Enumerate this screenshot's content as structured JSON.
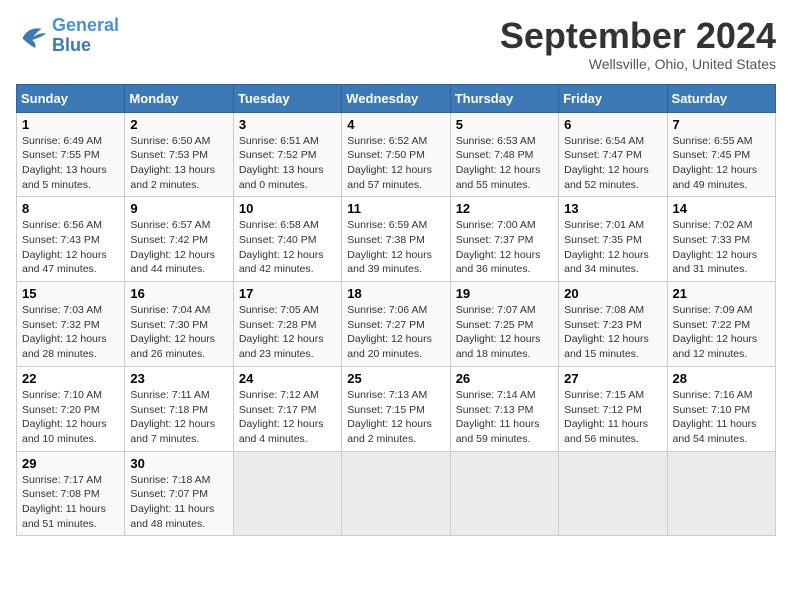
{
  "header": {
    "logo_line1": "General",
    "logo_line2": "Blue",
    "month_title": "September 2024",
    "location": "Wellsville, Ohio, United States"
  },
  "calendar": {
    "days_of_week": [
      "Sunday",
      "Monday",
      "Tuesday",
      "Wednesday",
      "Thursday",
      "Friday",
      "Saturday"
    ],
    "weeks": [
      [
        {
          "day": null,
          "empty": true
        },
        {
          "day": null,
          "empty": true
        },
        {
          "day": null,
          "empty": true
        },
        {
          "day": null,
          "empty": true
        },
        {
          "day": null,
          "empty": true
        },
        {
          "day": null,
          "empty": true
        },
        {
          "day": null,
          "empty": true
        }
      ],
      [
        {
          "day": "1",
          "sunrise": "6:49 AM",
          "sunset": "7:55 PM",
          "daylight": "13 hours and 5 minutes."
        },
        {
          "day": "2",
          "sunrise": "6:50 AM",
          "sunset": "7:53 PM",
          "daylight": "13 hours and 2 minutes."
        },
        {
          "day": "3",
          "sunrise": "6:51 AM",
          "sunset": "7:52 PM",
          "daylight": "13 hours and 0 minutes."
        },
        {
          "day": "4",
          "sunrise": "6:52 AM",
          "sunset": "7:50 PM",
          "daylight": "12 hours and 57 minutes."
        },
        {
          "day": "5",
          "sunrise": "6:53 AM",
          "sunset": "7:48 PM",
          "daylight": "12 hours and 55 minutes."
        },
        {
          "day": "6",
          "sunrise": "6:54 AM",
          "sunset": "7:47 PM",
          "daylight": "12 hours and 52 minutes."
        },
        {
          "day": "7",
          "sunrise": "6:55 AM",
          "sunset": "7:45 PM",
          "daylight": "12 hours and 49 minutes."
        }
      ],
      [
        {
          "day": "8",
          "sunrise": "6:56 AM",
          "sunset": "7:43 PM",
          "daylight": "12 hours and 47 minutes."
        },
        {
          "day": "9",
          "sunrise": "6:57 AM",
          "sunset": "7:42 PM",
          "daylight": "12 hours and 44 minutes."
        },
        {
          "day": "10",
          "sunrise": "6:58 AM",
          "sunset": "7:40 PM",
          "daylight": "12 hours and 42 minutes."
        },
        {
          "day": "11",
          "sunrise": "6:59 AM",
          "sunset": "7:38 PM",
          "daylight": "12 hours and 39 minutes."
        },
        {
          "day": "12",
          "sunrise": "7:00 AM",
          "sunset": "7:37 PM",
          "daylight": "12 hours and 36 minutes."
        },
        {
          "day": "13",
          "sunrise": "7:01 AM",
          "sunset": "7:35 PM",
          "daylight": "12 hours and 34 minutes."
        },
        {
          "day": "14",
          "sunrise": "7:02 AM",
          "sunset": "7:33 PM",
          "daylight": "12 hours and 31 minutes."
        }
      ],
      [
        {
          "day": "15",
          "sunrise": "7:03 AM",
          "sunset": "7:32 PM",
          "daylight": "12 hours and 28 minutes."
        },
        {
          "day": "16",
          "sunrise": "7:04 AM",
          "sunset": "7:30 PM",
          "daylight": "12 hours and 26 minutes."
        },
        {
          "day": "17",
          "sunrise": "7:05 AM",
          "sunset": "7:28 PM",
          "daylight": "12 hours and 23 minutes."
        },
        {
          "day": "18",
          "sunrise": "7:06 AM",
          "sunset": "7:27 PM",
          "daylight": "12 hours and 20 minutes."
        },
        {
          "day": "19",
          "sunrise": "7:07 AM",
          "sunset": "7:25 PM",
          "daylight": "12 hours and 18 minutes."
        },
        {
          "day": "20",
          "sunrise": "7:08 AM",
          "sunset": "7:23 PM",
          "daylight": "12 hours and 15 minutes."
        },
        {
          "day": "21",
          "sunrise": "7:09 AM",
          "sunset": "7:22 PM",
          "daylight": "12 hours and 12 minutes."
        }
      ],
      [
        {
          "day": "22",
          "sunrise": "7:10 AM",
          "sunset": "7:20 PM",
          "daylight": "12 hours and 10 minutes."
        },
        {
          "day": "23",
          "sunrise": "7:11 AM",
          "sunset": "7:18 PM",
          "daylight": "12 hours and 7 minutes."
        },
        {
          "day": "24",
          "sunrise": "7:12 AM",
          "sunset": "7:17 PM",
          "daylight": "12 hours and 4 minutes."
        },
        {
          "day": "25",
          "sunrise": "7:13 AM",
          "sunset": "7:15 PM",
          "daylight": "12 hours and 2 minutes."
        },
        {
          "day": "26",
          "sunrise": "7:14 AM",
          "sunset": "7:13 PM",
          "daylight": "11 hours and 59 minutes."
        },
        {
          "day": "27",
          "sunrise": "7:15 AM",
          "sunset": "7:12 PM",
          "daylight": "11 hours and 56 minutes."
        },
        {
          "day": "28",
          "sunrise": "7:16 AM",
          "sunset": "7:10 PM",
          "daylight": "11 hours and 54 minutes."
        }
      ],
      [
        {
          "day": "29",
          "sunrise": "7:17 AM",
          "sunset": "7:08 PM",
          "daylight": "11 hours and 51 minutes."
        },
        {
          "day": "30",
          "sunrise": "7:18 AM",
          "sunset": "7:07 PM",
          "daylight": "11 hours and 48 minutes."
        },
        {
          "day": null,
          "empty": true
        },
        {
          "day": null,
          "empty": true
        },
        {
          "day": null,
          "empty": true
        },
        {
          "day": null,
          "empty": true
        },
        {
          "day": null,
          "empty": true
        }
      ]
    ]
  }
}
